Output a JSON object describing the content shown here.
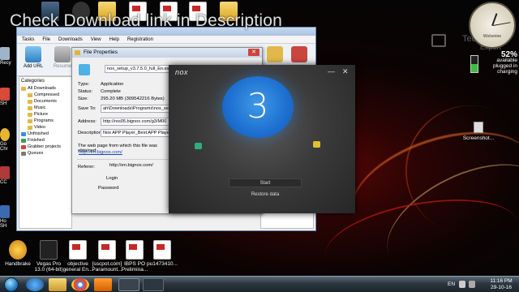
{
  "overlay_title": "Check Download link in Description",
  "desktop": {
    "bottom_icons": [
      {
        "label": "Handbrake",
        "icon": "handbrake-icon"
      },
      {
        "label": "Vegas Pro 13.0 (64-bit)",
        "icon": "vegas-icon"
      },
      {
        "label": "objective general En...",
        "icon": "pdf-icon"
      },
      {
        "label": "[sscpot.com] Paramount...",
        "icon": "pdf-icon"
      },
      {
        "label": "IBPS PO Prelimina...",
        "icon": "pdf-icon"
      },
      {
        "label": "pu1473410...",
        "icon": "pdf-icon"
      }
    ],
    "left_edge_labels": [
      "Recy",
      "SH",
      "Go Chr",
      "CC",
      "Ho SH"
    ],
    "screenshot_icon_label": "Screenshot...",
    "tech_logo": {
      "line1": "Tech Know",
      "line2": "Expert"
    }
  },
  "clock_gadget": {
    "brand": "Wolverine"
  },
  "battery_gadget": {
    "percent": "52%",
    "status1": "available",
    "status2": "plugged in",
    "status3": "charging",
    "fill_fraction": 0.52
  },
  "idm": {
    "menu": [
      "Tasks",
      "File",
      "Downloads",
      "View",
      "Help",
      "Registration"
    ],
    "toolbar": {
      "add_url": "Add URL",
      "resume": "Resume"
    },
    "categories_header": "Categories",
    "categories": [
      "All Downloads",
      "Compressed",
      "Documents",
      "Music",
      "Picture",
      "Programs",
      "Video",
      "Unfinished",
      "Finished",
      "Grabber projects",
      "Queues"
    ]
  },
  "file_properties": {
    "title": "File Properties",
    "filename": "nox_setup_v3.7.5.0_full_En.exe",
    "labels": {
      "type": "Type:",
      "status": "Status:",
      "size": "Size:",
      "save_to": "Save To:",
      "address": "Address:",
      "description": "Description:",
      "source_note": "The web page from which this file was obtained:",
      "referer": "Referer:",
      "login": "Login",
      "password": "Password"
    },
    "values": {
      "type": "Application",
      "status": "Complete",
      "size": "295.20  MB (309542216 Bytes)",
      "save_to": "ah\\Downloads\\Programs\\nox_se",
      "address": "http://res05.bignox.com/g3/M00",
      "description": "Nox APP Player_Best APP Player",
      "source_url": "http://en.bignox.com/",
      "referer": "http://en.bignox.com/"
    }
  },
  "nox": {
    "logo": "nox",
    "minimize": "—",
    "close": "✕",
    "countdown": "3",
    "start_label": "Start",
    "restore_label": "Restore data"
  },
  "taskbar": {
    "apps": [
      "start-orb",
      "ie-icon",
      "explorer-icon",
      "chrome-icon",
      "vlc-icon",
      "nox-icon",
      "nox-icon"
    ],
    "lang": "EN",
    "time": "11:16 PM",
    "date": "29-10-16"
  }
}
